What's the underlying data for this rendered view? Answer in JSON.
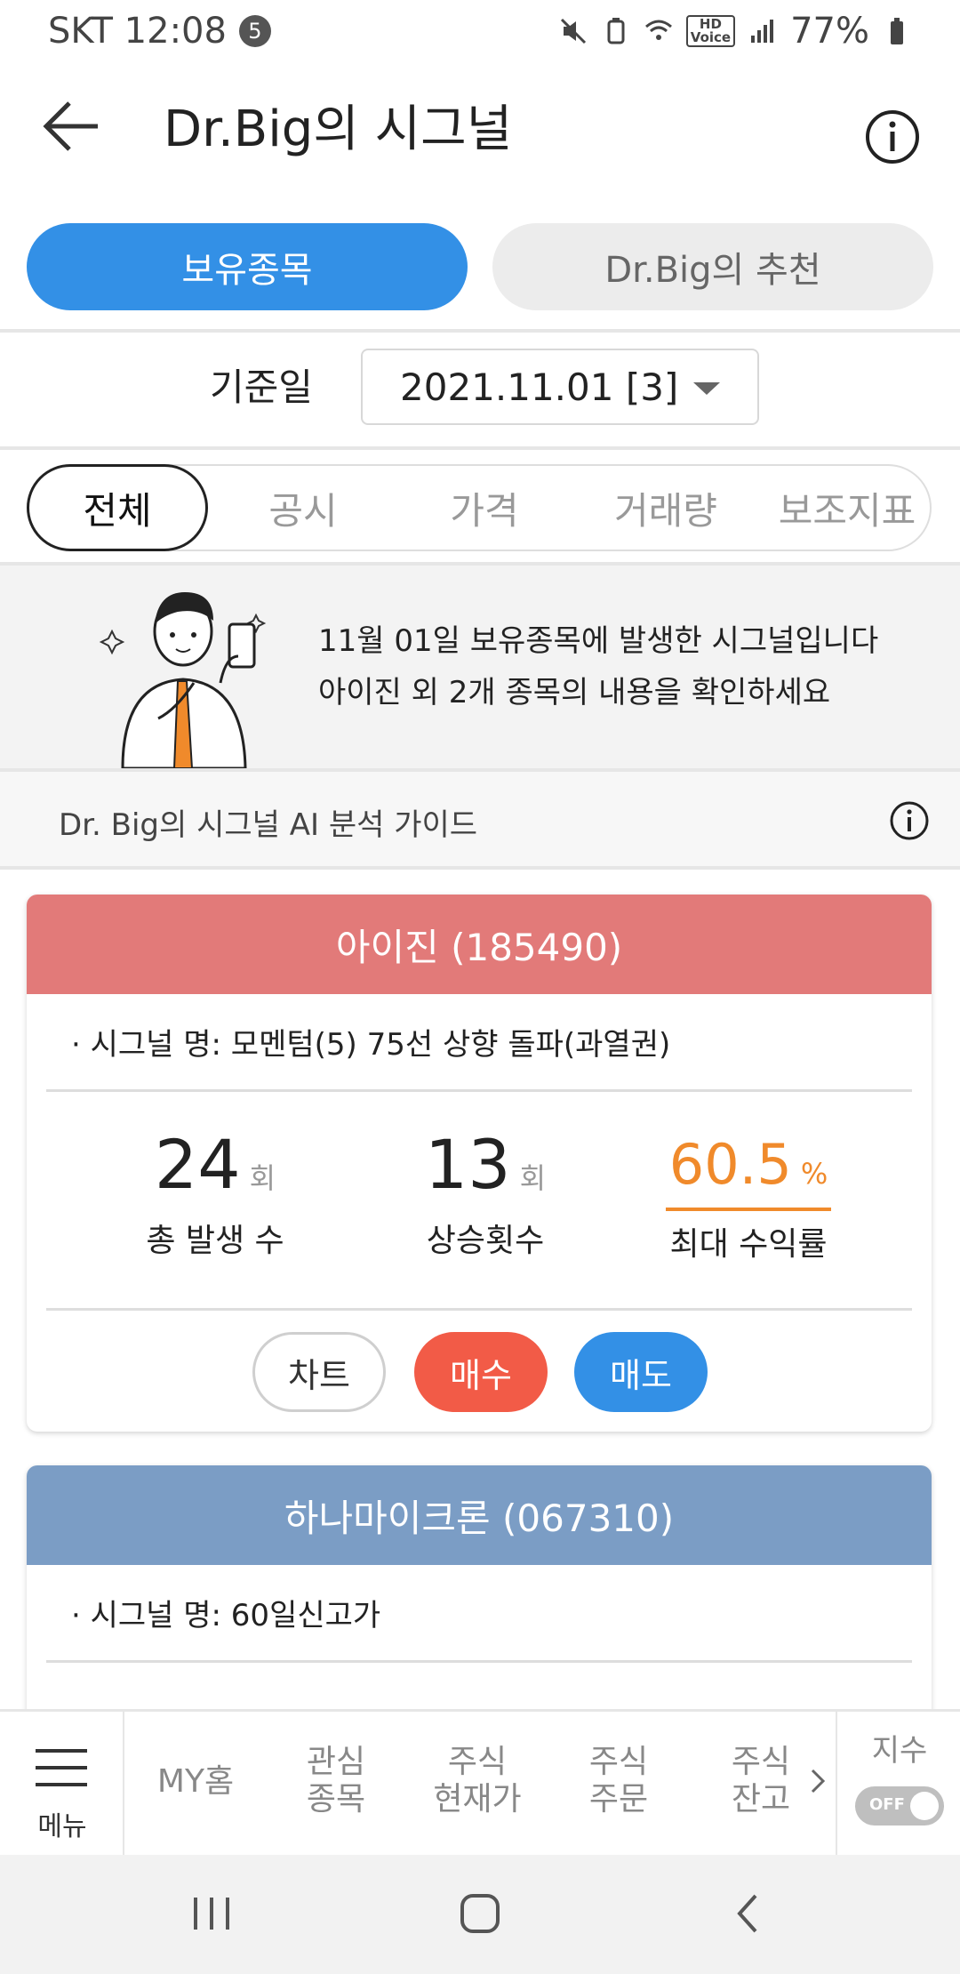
{
  "status_bar": {
    "carrier_time": "SKT 12:08",
    "notification_count": "5",
    "hd_voice": "HD\nVoice",
    "battery": "77%"
  },
  "header": {
    "title": "Dr.Big의 시그널"
  },
  "segments": {
    "holdings": "보유종목",
    "recommend": "Dr.Big의 추천"
  },
  "date_row": {
    "label": "기준일",
    "value": "2021.11.01  [3]"
  },
  "filter_tabs": [
    "전체",
    "공시",
    "가격",
    "거래량",
    "보조지표"
  ],
  "banner": {
    "line1": "11월 01일 보유종목에 발생한 시그널입니다",
    "line2": "아이진 외 2개 종목의 내용을 확인하세요"
  },
  "guide": {
    "text": "Dr. Big의 시그널 AI 분석 가이드"
  },
  "cards": [
    {
      "title": "아이진 (185490)",
      "signal": "· 시그널 명: 모멘텀(5) 75선 상향 돌파(과열권)",
      "stats": [
        {
          "value": "24",
          "unit": "회",
          "label": "총 발생 수"
        },
        {
          "value": "13",
          "unit": "회",
          "label": "상승횟수"
        },
        {
          "value": "60.5",
          "unit": "%",
          "label": "최대 수익률"
        }
      ],
      "actions": {
        "chart": "차트",
        "buy": "매수",
        "sell": "매도"
      }
    },
    {
      "title": "하나마이크론 (067310)",
      "signal": "· 시그널 명: 60일신고가"
    }
  ],
  "bottom_nav": {
    "menu": "메뉴",
    "items": [
      "MY홈",
      "관심\n종목",
      "주식\n현재가",
      "주식\n주문",
      "주식\n잔고"
    ],
    "index_label": "지수",
    "toggle": "OFF"
  },
  "colors": {
    "primary_blue": "#3390e6",
    "card_red": "#e27a79",
    "card_blue": "#7b9dc5",
    "orange": "#f08a2b",
    "buy_red": "#f25b47"
  }
}
